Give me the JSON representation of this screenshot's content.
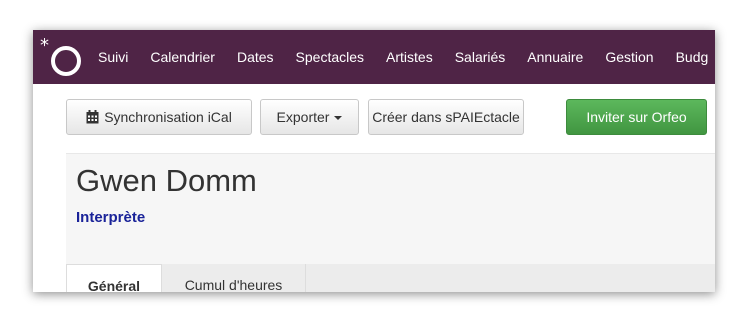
{
  "navbar": {
    "items": [
      "Suivi",
      "Calendrier",
      "Dates",
      "Spectacles",
      "Artistes",
      "Salariés",
      "Annuaire",
      "Gestion",
      "Budg"
    ],
    "background": "#4f2446"
  },
  "toolbar": {
    "ical_label": "Synchronisation iCal",
    "export_label": "Exporter",
    "create_label": "Créer dans sPAIEctacle",
    "invite_label": "Inviter sur Orfeo",
    "invite_color": "#5cb85c"
  },
  "profile": {
    "name": "Gwen Domm",
    "role": "Interprète",
    "role_color": "#1a2399"
  },
  "tabs": [
    {
      "label": "Général"
    },
    {
      "label": "Cumul d'heures"
    }
  ]
}
